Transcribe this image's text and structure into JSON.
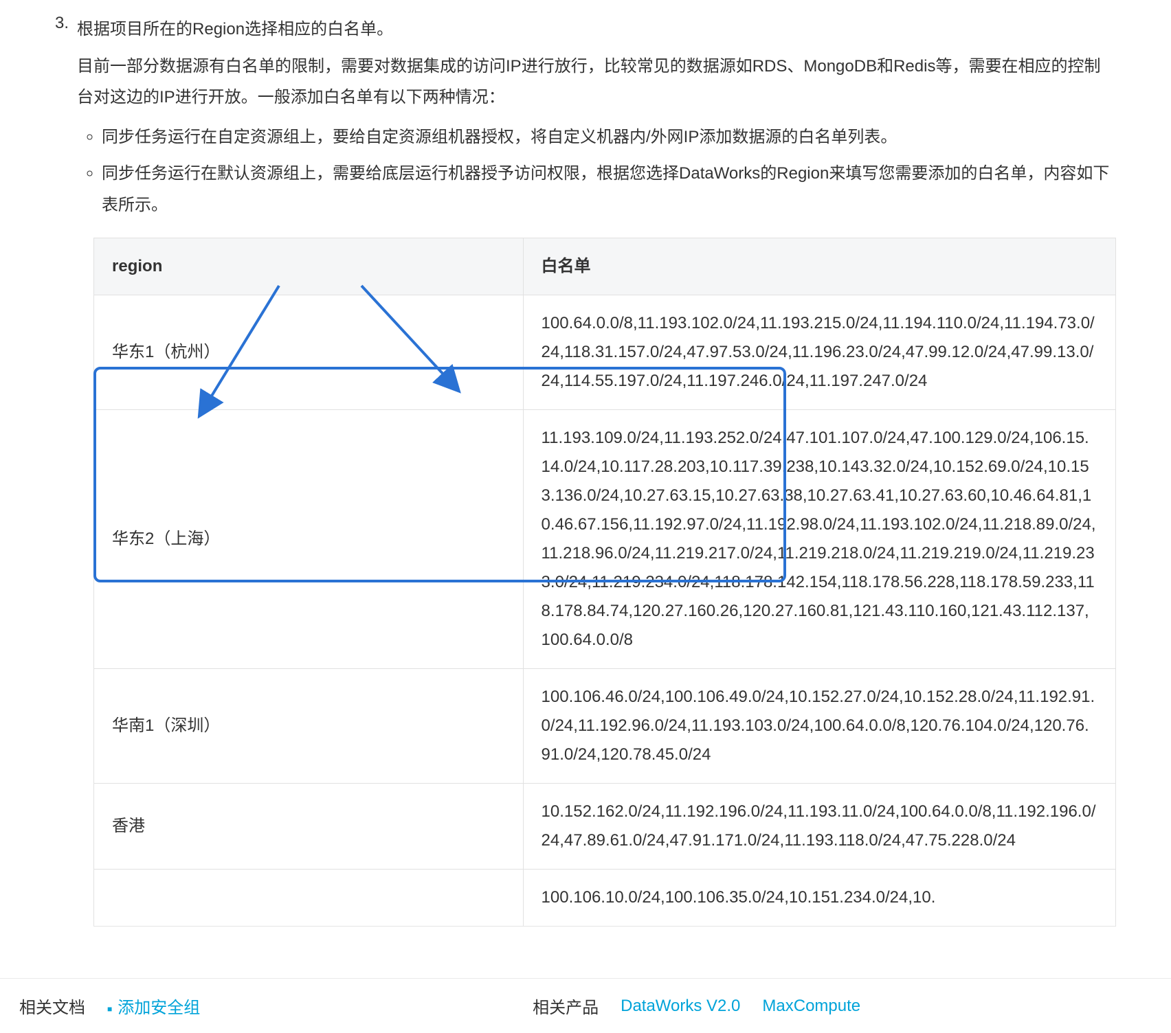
{
  "step": {
    "number": "3.",
    "title": "根据项目所在的Region选择相应的白名单。",
    "desc": "目前一部分数据源有白名单的限制，需要对数据集成的访问IP进行放行，比较常见的数据源如RDS、MongoDB和Redis等，需要在相应的控制台对这边的IP进行开放。一般添加白名单有以下两种情况：",
    "bullets": [
      "同步任务运行在自定资源组上，要给自定资源组机器授权，将自定义机器内/外网IP添加数据源的白名单列表。",
      "同步任务运行在默认资源组上，需要给底层运行机器授予访问权限，根据您选择DataWorks的Region来填写您需要添加的白名单，内容如下表所示。"
    ]
  },
  "table": {
    "headers": {
      "col1": "region",
      "col2": "白名单"
    },
    "rows": [
      {
        "region": "华东1（杭州）",
        "whitelist": "100.64.0.0/8,11.193.102.0/24,11.193.215.0/24,11.194.110.0/24,11.194.73.0/24,118.31.157.0/24,47.97.53.0/24,11.196.23.0/24,47.99.12.0/24,47.99.13.0/24,114.55.197.0/24,11.197.246.0/24,11.197.247.0/24"
      },
      {
        "region": "华东2（上海）",
        "whitelist": "11.193.109.0/24,11.193.252.0/24,47.101.107.0/24,47.100.129.0/24,106.15.14.0/24,10.117.28.203,10.117.39.238,10.143.32.0/24,10.152.69.0/24,10.153.136.0/24,10.27.63.15,10.27.63.38,10.27.63.41,10.27.63.60,10.46.64.81,10.46.67.156,11.192.97.0/24,11.192.98.0/24,11.193.102.0/24,11.218.89.0/24,11.218.96.0/24,11.219.217.0/24,11.219.218.0/24,11.219.219.0/24,11.219.233.0/24,11.219.234.0/24,118.178.142.154,118.178.56.228,118.178.59.233,118.178.84.74,120.27.160.26,120.27.160.81,121.43.110.160,121.43.112.137,100.64.0.0/8"
      },
      {
        "region": "华南1（深圳）",
        "whitelist": "100.106.46.0/24,100.106.49.0/24,10.152.27.0/24,10.152.28.0/24,11.192.91.0/24,11.192.96.0/24,11.193.103.0/24,100.64.0.0/8,120.76.104.0/24,120.76.91.0/24,120.78.45.0/24"
      },
      {
        "region": "香港",
        "whitelist": "10.152.162.0/24,11.192.196.0/24,11.193.11.0/24,100.64.0.0/8,11.192.196.0/24,47.89.61.0/24,47.91.171.0/24,11.193.118.0/24,47.75.228.0/24"
      },
      {
        "region": "",
        "whitelist": "100.106.10.0/24,100.106.35.0/24,10.151.234.0/24,10."
      }
    ]
  },
  "footer": {
    "docs_label": "相关文档",
    "docs_link1": "添加安全组",
    "products_label": "相关产品",
    "products_link1": "DataWorks V2.0",
    "products_link2": "MaxCompute"
  }
}
